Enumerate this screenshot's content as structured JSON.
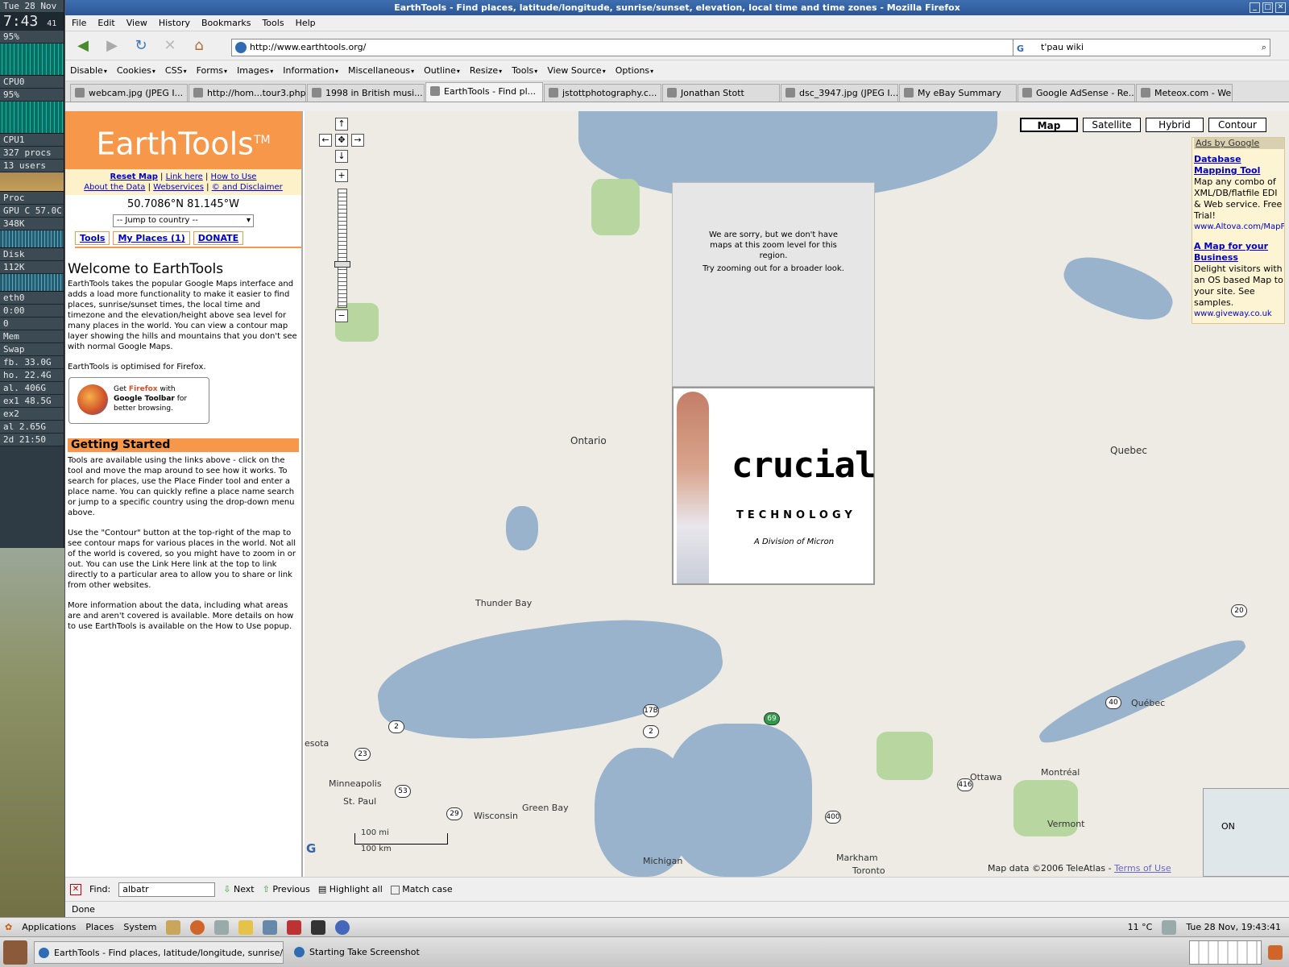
{
  "gkrellm": {
    "date": "Tue 28 Nov",
    "time": "7:43",
    "secs": "41",
    "cpu_pct_1": "95%",
    "cpu0_label": "CPU0",
    "cpu_pct_2": "95%",
    "cpu1_label": "CPU1",
    "procs": "327 procs",
    "users": "13 users",
    "proc_label": "Proc",
    "gpu": "GPU C 57.0C",
    "mem1": "348K",
    "disk_label": "Disk",
    "disk_val": "112K",
    "eth_label": "eth0",
    "eth_val": "0:00",
    "eth_zero": "0",
    "mem_label": "Mem",
    "swap_label": "Swap",
    "fs1": "fb. 33.0G",
    "fs2": "ho. 22.4G",
    "fs3": "al. 406G",
    "fs4": "ex1 48.5G",
    "fs5": "ex2",
    "fs6": "al 2.65G",
    "uptime": "2d 21:50"
  },
  "window": {
    "title": "EarthTools - Find places, latitude/longitude, sunrise/sunset, elevation, local time and time zones - Mozilla Firefox"
  },
  "menu": [
    "File",
    "Edit",
    "View",
    "History",
    "Bookmarks",
    "Tools",
    "Help"
  ],
  "nav": {
    "url": "http://www.earthtools.org/",
    "search": "t'pau wiki"
  },
  "webdev": [
    "Disable",
    "Cookies",
    "CSS",
    "Forms",
    "Images",
    "Information",
    "Miscellaneous",
    "Outline",
    "Resize",
    "Tools",
    "View Source",
    "Options"
  ],
  "tabs": [
    "webcam.jpg (JPEG I...",
    "http://hom...tour3.php",
    "1998 in British musi...",
    "EarthTools - Find pl...",
    "jstottphotography.c...",
    "Jonathan Stott",
    "dsc_3947.jpg (JPEG I...",
    "My eBay Summary",
    "Google AdSense - Re...",
    "Meteox.com - Weath..."
  ],
  "left": {
    "logo": "EarthTools",
    "tm": "TM",
    "links1": [
      "Reset Map",
      "Link here",
      "How to Use"
    ],
    "links2": [
      "About the Data",
      "Webservices",
      "© and Disclaimer"
    ],
    "coords": "50.7086°N 81.145°W",
    "jump": "-- Jump to country --",
    "tabs": [
      "Tools",
      "My Places (1)",
      "DONATE"
    ],
    "welcome_title": "Welcome to EarthTools",
    "p1": "EarthTools takes the popular Google Maps interface and adds a load more functionality to make it easier to find places, sunrise/sunset times, the local time and timezone and the elevation/height above sea level for many places in the world. You can view a contour map layer showing the hills and mountains that you don't see with normal Google Maps.",
    "p2": "EarthTools is optimised for Firefox.",
    "ff_get": "Get",
    "ff_firefox": "Firefox",
    "ff_with": "with",
    "ff_toolbar": "Google Toolbar",
    "ff_for": "for better browsing.",
    "gs_title": "Getting Started",
    "p3": "Tools are available using the links above - click on the tool and move the map around to see how it works. To search for places, use the Place Finder tool and enter a place name. You can quickly refine a place name search or jump to a specific country using the drop-down menu above.",
    "p4": "Use the \"Contour\" button at the top-right of the map to see contour maps for various places in the world. Not all of the world is covered, so you might have to zoom in or out. You can use the Link Here link at the top to link directly to a particular area to allow you to share or link from other websites.",
    "p5": "More information about the data, including what areas are and aren't covered is available. More details on how to use EarthTools is available on the How to Use popup."
  },
  "map": {
    "buttons": [
      "Map",
      "Satellite",
      "Hybrid",
      "Contour"
    ],
    "sorry": "We are sorry, but we don't have maps at this zoom level for this region.",
    "sorry2": "Try zooming out for a broader look.",
    "ad_word": "crucial",
    "ad_sub": "TECHNOLOGY",
    "ad_sub2": "A Division of Micron",
    "ads_header": "Ads by Google",
    "ad1_title": "Database Mapping Tool",
    "ad1_text": "Map any combo of XML/DB/flatfile EDI & Web service. Free Trial!",
    "ad1_url": "www.Altova.com/MapFo",
    "ad2_title": "A Map for your Business",
    "ad2_text": "Delight visitors with an OS based Map to your site. See samples.",
    "ad2_url": "www.giveway.co.uk",
    "places": [
      "Ontario",
      "Quebec",
      "Thunder Bay",
      "Minneapolis",
      "St. Paul",
      "Wisconsin",
      "Green Bay",
      "Michigan",
      "Ottawa",
      "Montréal",
      "Québec",
      "Vermont",
      "Markham",
      "Toronto",
      "esota"
    ],
    "scale_mi": "100 mi",
    "scale_km": "100 km",
    "mapdata": "Map data ©2006 TeleAtlas -",
    "terms": "Terms of Use",
    "minimap_label": "ON"
  },
  "find": {
    "label": "Find:",
    "value": "albatr",
    "next": "Next",
    "previous": "Previous",
    "highlight": "Highlight all",
    "match": "Match case"
  },
  "status": "Done",
  "panel": {
    "menus": [
      "Applications",
      "Places",
      "System"
    ],
    "temp": "11 °C",
    "clock": "Tue 28 Nov, 19:43:41",
    "task1": "EarthTools - Find places, latitude/longitude, sunrise/sun...",
    "task2": "Starting Take Screenshot"
  },
  "colors": {
    "orange": "#f7974a",
    "water": "#99b3cc",
    "land": "#eeebe4",
    "link": "#0000cc"
  }
}
